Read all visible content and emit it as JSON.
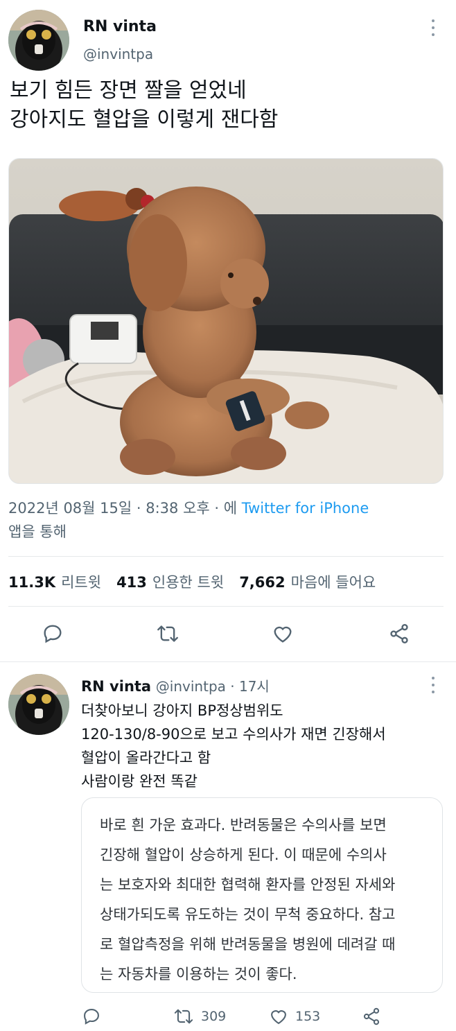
{
  "main_tweet": {
    "author_name": "RN vinta",
    "author_handle": "@invintpa",
    "text": "보기 힘든 장면 짤을 얻었네\n강아지도 혈압을 이렇게 잰다함",
    "date": "2022년 08월 15일",
    "time": "8:38 오후",
    "source_prefix": "에",
    "source": "Twitter for iPhone",
    "source_suffix": "앱을 통해",
    "retweets_count": "11.3K",
    "retweets_label": "리트윗",
    "quotes_count": "413",
    "quotes_label": "인용한 트윗",
    "likes_count": "7,662",
    "likes_label": "마음에 들어요",
    "action_icons": [
      "reply-icon",
      "retweet-icon",
      "like-icon",
      "share-icon"
    ]
  },
  "reply_tweet": {
    "author_name": "RN vinta",
    "author_handle": "@invintpa",
    "time": "17시",
    "text": "더찾아보니 강아지 BP정상범위도\n120-130/8-90으로 보고 수의사가 재면 긴장해서\n혈압이 올라간다고 함\n사람이랑 완전 똑같",
    "quote_lines": [
      "바로 흰 가운 효과다. 반려동물은 수의사를 보면",
      "긴장해 혈압이 상승하게 된다. 이 때문에 수의사",
      "는 보호자와 최대한 협력해 환자를 안정된 자세와",
      "상태가되도록 유도하는 것이 무척 중요하다. 참고",
      "로 혈압측정을 위해 반려동물을 병원에 데려갈 때",
      "는 자동차를 이용하는 것이 좋다."
    ],
    "retweet_count": "309",
    "like_count": "153"
  },
  "colors": {
    "text": "#0f1419",
    "secondary": "#536471",
    "link": "#1d9bf0"
  }
}
